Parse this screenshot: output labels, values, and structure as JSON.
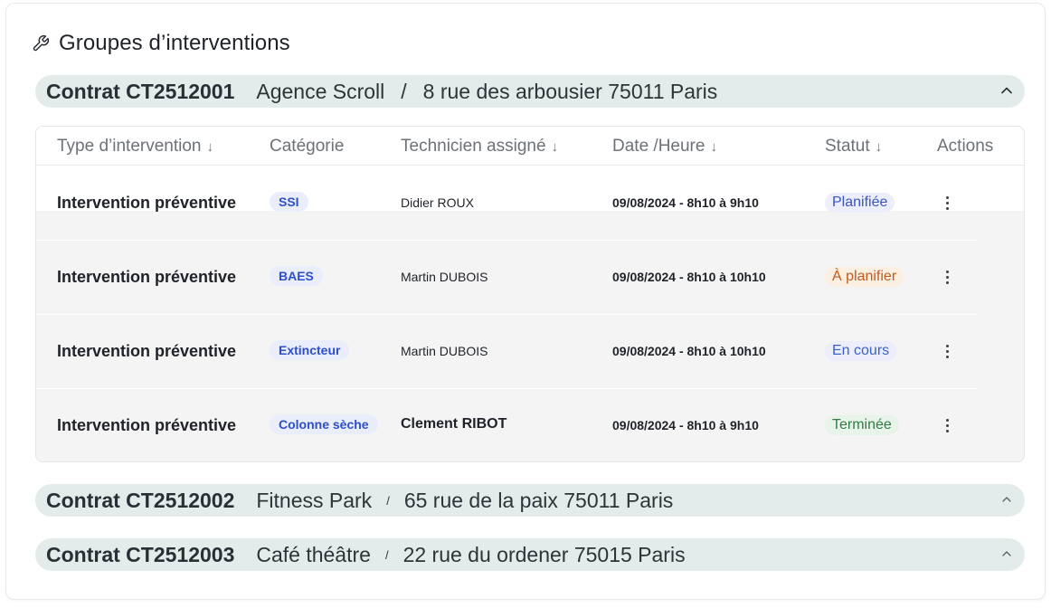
{
  "panel": {
    "title": "Groupes d’interventions"
  },
  "contracts": [
    {
      "code": "Contrat CT2512001",
      "name": "Agence Scroll",
      "sep": "/",
      "address": "8 rue des arbousier  75011 Paris",
      "expanded": true
    },
    {
      "code": "Contrat CT2512002",
      "name": "Fitness Park",
      "sep": "/",
      "address": "65 rue de la paix  75011 Paris",
      "expanded": false
    },
    {
      "code": "Contrat CT2512003",
      "name": "Café théâtre",
      "sep": "/",
      "address": "22 rue du ordener  75015 Paris",
      "expanded": false
    }
  ],
  "table": {
    "columns": [
      {
        "label": "Type d’intervention",
        "sortable": true
      },
      {
        "label": "Catégorie",
        "sortable": false
      },
      {
        "label": "Technicien assigné",
        "sortable": true
      },
      {
        "label": "Date /Heure",
        "sortable": true
      },
      {
        "label": "Statut",
        "sortable": true
      },
      {
        "label": "Actions",
        "sortable": false
      }
    ],
    "sort_icon": "↓",
    "rows": [
      {
        "type": "Intervention préventive",
        "category": "SSI",
        "technician": "Didier ROUX",
        "datetime": "09/08/2024 -  8h10 à 9h10",
        "status": "Planifiée",
        "status_color": "#3a55c2"
      },
      {
        "type": "Intervention préventive",
        "category": "BAES",
        "technician": "Martin DUBOIS",
        "datetime": "09/08/2024 -  8h10 à 10h10",
        "status": "À planifier",
        "status_color": "#c25a1e"
      },
      {
        "type": "Intervention préventive",
        "category": "Extincteur",
        "technician": "Martin DUBOIS",
        "datetime": "09/08/2024 -  8h10 à 10h10",
        "status": "En cours",
        "status_color": "#3a62c8"
      },
      {
        "type": "Intervention préventive",
        "category": "Colonne sèche",
        "technician": "Clement RIBOT",
        "datetime": "09/08/2024 - 8h10 à 9h10",
        "status": "Terminée",
        "status_color": "#2f7d45"
      }
    ]
  },
  "icons": {
    "title": "wrench-icon",
    "collapse": "chevron-up-icon",
    "actions": "more-vertical-icon"
  }
}
